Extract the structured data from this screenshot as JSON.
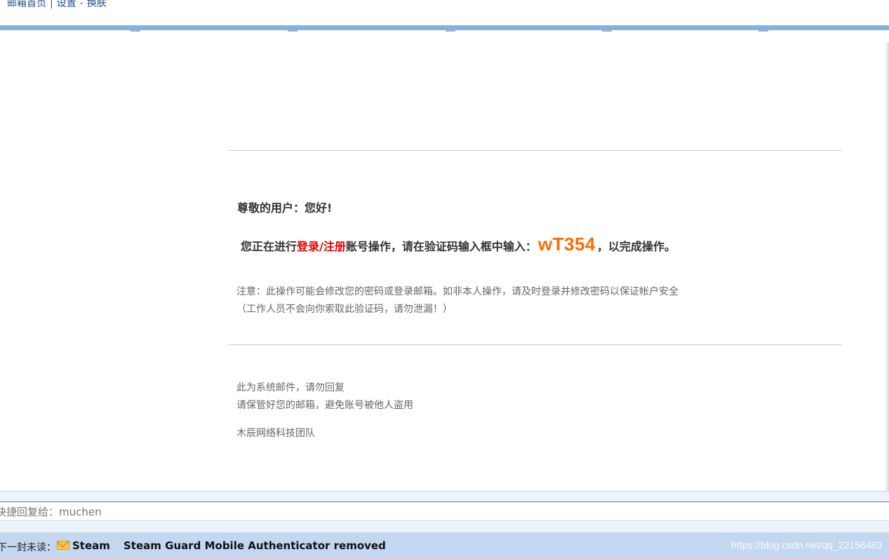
{
  "topnav": {
    "home": "邮箱首页",
    "sep": "|",
    "settings": "设置",
    "dash": "-",
    "skin": "换肤"
  },
  "email": {
    "greeting": "尊敬的用户：您好!",
    "instruction_pre": "您正在进行",
    "instruction_action": "登录/注册",
    "instruction_mid": "账号操作，请在验证码输入框中输入：",
    "code": "wT354",
    "instruction_post": "，以完成操作。",
    "note_line1": "注意：此操作可能会修改您的密码或登录邮箱。如非本人操作，请及时登录并修改密码以保证帐户安全",
    "note_line2": "（工作人员不会向你索取此验证码，请勿泄漏！）",
    "footer_line1": "此为系统邮件，请勿回复",
    "footer_line2": "请保管好您的邮箱，避免账号被他人盗用",
    "signature": "木辰网络科技团队"
  },
  "quick_reply": {
    "text": "快捷回复给：muchen"
  },
  "next_unread": {
    "label": "下一封未读：",
    "icon": "envelope-icon",
    "sender": "Steam",
    "subject": "Steam Guard Mobile Authenticator removed"
  },
  "watermark": "https://blog.csdn.net/qq_22156483",
  "colors": {
    "topbar": "#86b0e0",
    "red_action": "#e60000",
    "code_orange": "#ff6b00",
    "next_bar": "#c3d8f0"
  }
}
